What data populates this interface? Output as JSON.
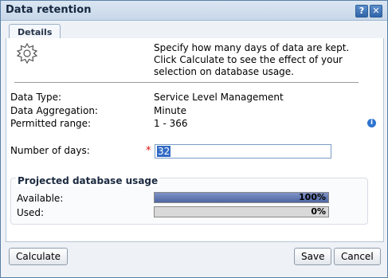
{
  "window": {
    "title": "Data retention",
    "help_glyph": "?",
    "close_glyph": "✕"
  },
  "tabs": [
    {
      "label": "Details"
    }
  ],
  "intro_text": "Specify how many days of data are kept. Click Calculate to see the effect of your selection on database usage.",
  "fields": {
    "data_type": {
      "label": "Data Type:",
      "value": "Service Level Management"
    },
    "data_aggregation": {
      "label": "Data Aggregation:",
      "value": "Minute"
    },
    "permitted_range": {
      "label": "Permitted range:",
      "value": "1 - 366"
    }
  },
  "days": {
    "label": "Number of days:",
    "required_marker": "*",
    "value": "32"
  },
  "usage": {
    "title": "Projected database usage",
    "available": {
      "label": "Available:",
      "percent": 100,
      "text": "100%"
    },
    "used": {
      "label": "Used:",
      "percent": 0,
      "text": "0%"
    }
  },
  "buttons": {
    "calculate": "Calculate",
    "save": "Save",
    "cancel": "Cancel"
  },
  "icons": {
    "gear": "gear-icon",
    "info": "info-icon"
  },
  "colors": {
    "title_bar": "#c7d7e9",
    "progress_fill": "#4e66a3",
    "required": "#dd1111",
    "selection": "#316ac5"
  }
}
